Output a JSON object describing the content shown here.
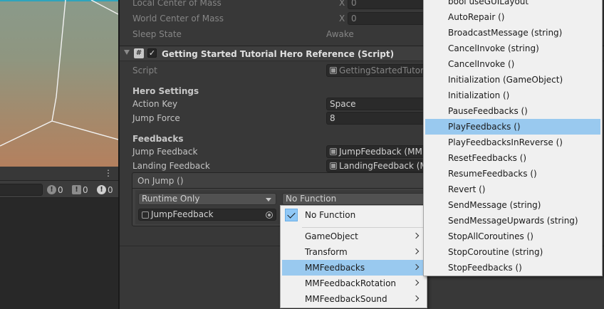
{
  "console": {
    "menu_glyph": "⋮",
    "info_count": "0",
    "warn_count": "0",
    "error_count": "0"
  },
  "rigidbody": {
    "local_center_of_mass": {
      "label": "Local Center of Mass",
      "x_label": "X",
      "x_value": "0"
    },
    "world_center_of_mass": {
      "label": "World Center of Mass",
      "x_label": "X",
      "x_value": "0"
    },
    "sleep_state": {
      "label": "Sleep State",
      "value": "Awake"
    }
  },
  "component": {
    "icon_glyph": "#",
    "enabled_glyph": "✓",
    "title": "Getting Started Tutorial Hero Reference (Script)",
    "script_label": "Script",
    "script_value": "GettingStartedTutoria",
    "hero_settings_heading": "Hero Settings",
    "action_key_label": "Action Key",
    "action_key_value": "Space",
    "jump_force_label": "Jump Force",
    "jump_force_value": "8",
    "feedbacks_heading": "Feedbacks",
    "jump_feedback_label": "Jump Feedback",
    "jump_feedback_value": "JumpFeedback (MM",
    "landing_feedback_label": "Landing Feedback",
    "landing_feedback_value": "LandingFeedback (M"
  },
  "event": {
    "header": "On Jump ()",
    "call_state": "Runtime Only",
    "function": "No Function",
    "target_object": "JumpFeedback"
  },
  "function_menu": {
    "items": [
      {
        "label": "No Function",
        "checked": true
      },
      {
        "label": "GameObject",
        "submenu": true
      },
      {
        "label": "Transform",
        "submenu": true
      },
      {
        "label": "MMFeedbacks",
        "submenu": true,
        "highlighted": true
      },
      {
        "label": "MMFeedbackRotation",
        "submenu": true
      },
      {
        "label": "MMFeedbackSound",
        "submenu": true
      }
    ]
  },
  "submenu": {
    "items": [
      "bool useGUILayout",
      "AutoRepair ()",
      "BroadcastMessage (string)",
      "CancelInvoke (string)",
      "CancelInvoke ()",
      "Initialization (GameObject)",
      "Initialization ()",
      "PauseFeedbacks ()",
      "PlayFeedbacks ()",
      "PlayFeedbacksInReverse ()",
      "ResetFeedbacks ()",
      "ResumeFeedbacks ()",
      "Revert ()",
      "SendMessage (string)",
      "SendMessageUpwards (string)",
      "StopAllCoroutines ()",
      "StopCoroutine (string)",
      "StopFeedbacks ()"
    ],
    "highlighted_index": 8
  },
  "colors": {
    "editor_bg": "#383838",
    "menu_bg": "#f0f0f0",
    "menu_highlight": "#99c9ef",
    "scene_accent": "#2ea4bc"
  }
}
